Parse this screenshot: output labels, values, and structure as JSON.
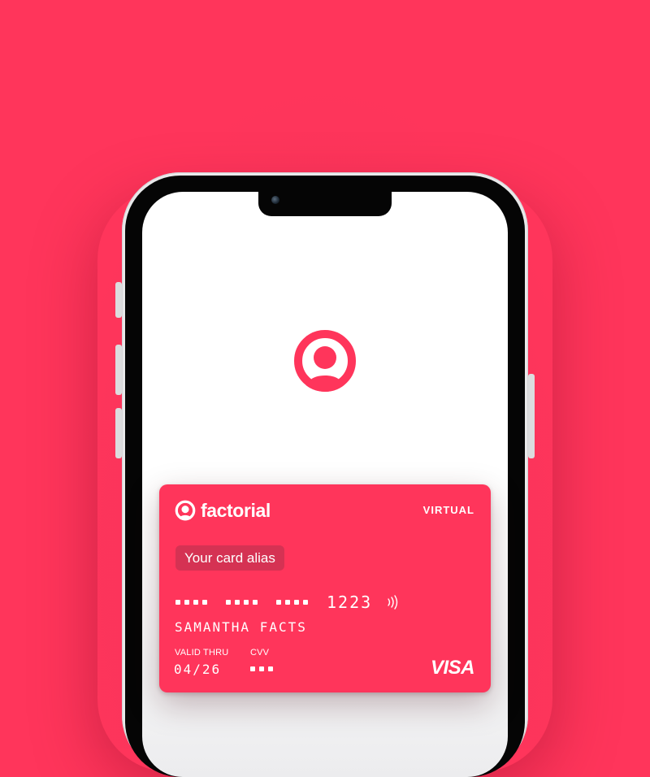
{
  "colors": {
    "brand": "#FF355B",
    "pill": "#D53253",
    "phone_frame": "#e9e9ea",
    "bezel": "#050505",
    "screen": "#ffffff"
  },
  "app": {
    "logo_icon": "factorial-user-icon"
  },
  "card": {
    "brand_name": "factorial",
    "type_label": "VIRTUAL",
    "alias": "Your card alias",
    "last4": "1223",
    "holder_name": "SAMANTHA FACTS",
    "valid_thru_label": "VALID THRU",
    "valid_thru_value": "04/26",
    "cvv_label": "CVV",
    "network": "VISA"
  }
}
